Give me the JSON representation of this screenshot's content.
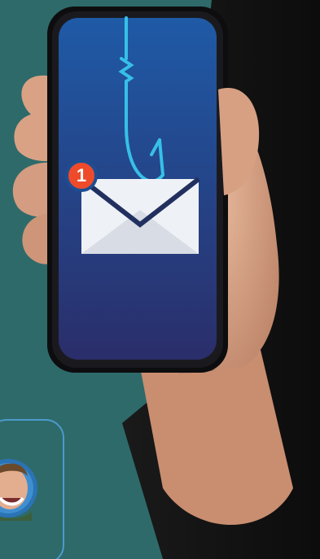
{
  "scene": {
    "background_color": "#2e6a6a",
    "phone_screen_gradient": [
      "#1f5aa6",
      "#2a2e6a"
    ],
    "hook_color": "#36c0e8",
    "accent_color": "#ee4b2b"
  },
  "notification": {
    "count": "1"
  },
  "icons": {
    "hook": "fishing-hook-icon",
    "envelope": "envelope-icon",
    "badge": "notification-badge",
    "avatar": "person-avatar"
  }
}
